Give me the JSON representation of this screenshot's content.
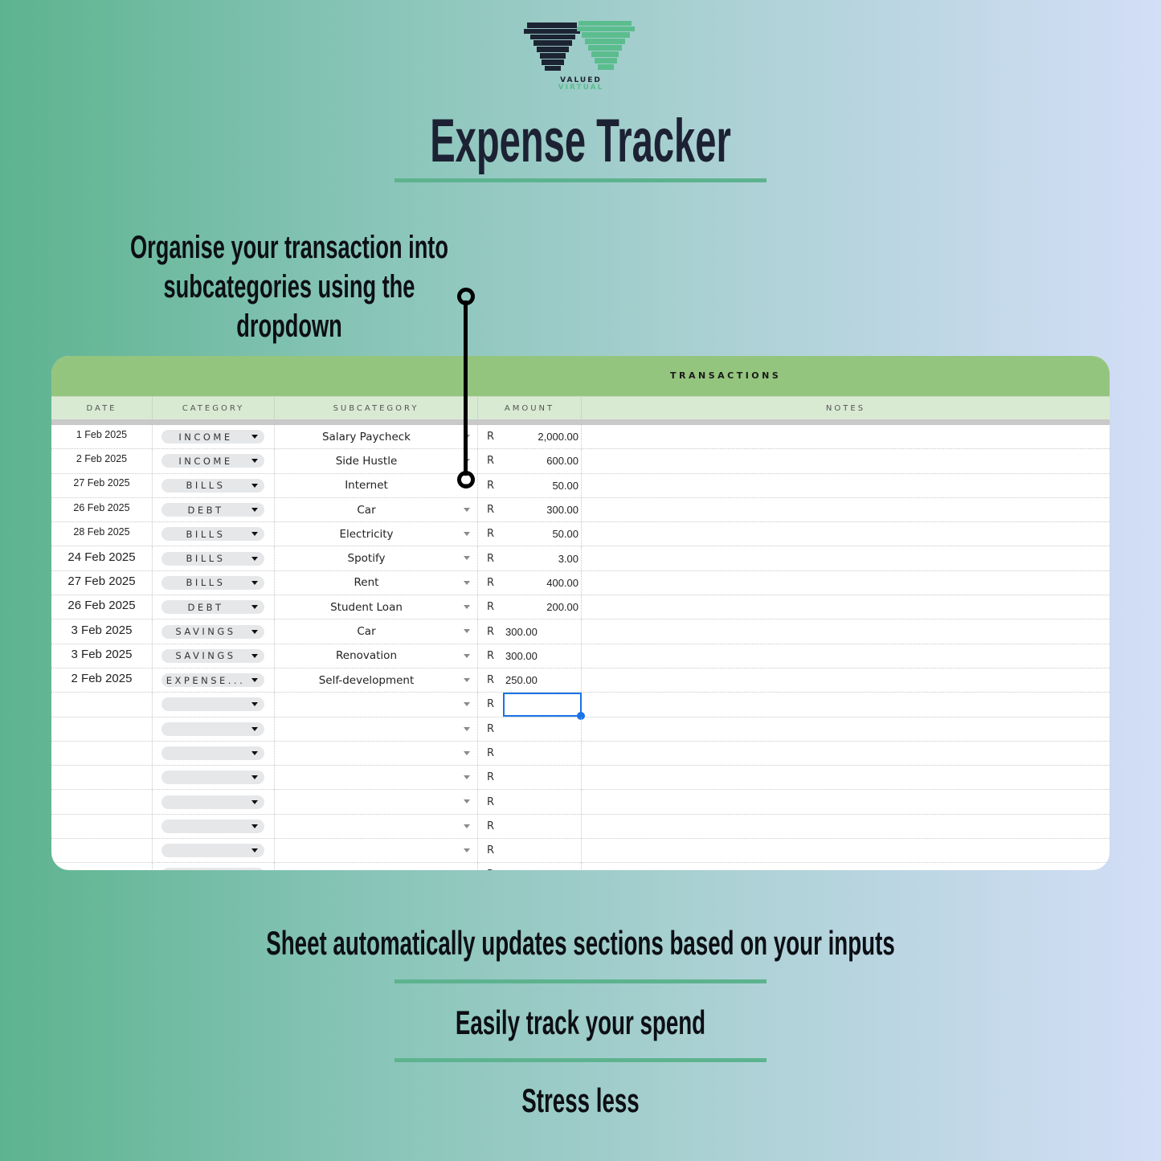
{
  "brand": {
    "logo_icon": "vv-glitch-logo-icon",
    "line1": "VALUED",
    "line2": "VIRTUAL",
    "colors": {
      "dark": "#1c2433",
      "green": "#5bbd8e"
    }
  },
  "title": "Expense Tracker",
  "callout": {
    "lines": [
      "Organise your transaction into",
      "subcategories using the",
      "dropdown"
    ]
  },
  "sheet": {
    "banner_title": "TRANSACTIONS",
    "columns": [
      "DATE",
      "CATEGORY",
      "SUBCATEGORY",
      "AMOUNT",
      "NOTES"
    ],
    "currency": "R",
    "rows": [
      {
        "date": "1 Feb 2025",
        "category": "INCOME",
        "subcategory": "Salary Paycheck",
        "amount": "2,000.00",
        "notes": ""
      },
      {
        "date": "2 Feb 2025",
        "category": "INCOME",
        "subcategory": "Side Hustle",
        "amount": "600.00",
        "notes": ""
      },
      {
        "date": "27 Feb 2025",
        "category": "BILLS",
        "subcategory": "Internet",
        "amount": "50.00",
        "notes": ""
      },
      {
        "date": "26 Feb 2025",
        "category": "DEBT",
        "subcategory": "Car",
        "amount": "300.00",
        "notes": ""
      },
      {
        "date": "28 Feb 2025",
        "category": "BILLS",
        "subcategory": "Electricity",
        "amount": "50.00",
        "notes": ""
      },
      {
        "date": "24 Feb 2025",
        "category": "BILLS",
        "subcategory": "Spotify",
        "amount": "3.00",
        "notes": ""
      },
      {
        "date": "27 Feb 2025",
        "category": "BILLS",
        "subcategory": "Rent",
        "amount": "400.00",
        "notes": ""
      },
      {
        "date": "26 Feb 2025",
        "category": "DEBT",
        "subcategory": "Student Loan",
        "amount": "200.00",
        "notes": ""
      },
      {
        "date": "3 Feb 2025",
        "category": "SAVINGS",
        "subcategory": "Car",
        "amount": "300.00",
        "notes": ""
      },
      {
        "date": "3 Feb 2025",
        "category": "SAVINGS",
        "subcategory": "Renovation",
        "amount": "300.00",
        "notes": ""
      },
      {
        "date": "2 Feb 2025",
        "category": "EXPENSE...",
        "subcategory": "Self-development",
        "amount": "250.00",
        "notes": ""
      },
      {
        "date": "",
        "category": "",
        "subcategory": "",
        "amount": "",
        "notes": "",
        "selected": true
      },
      {
        "date": "",
        "category": "",
        "subcategory": "",
        "amount": "",
        "notes": ""
      },
      {
        "date": "",
        "category": "",
        "subcategory": "",
        "amount": "",
        "notes": ""
      },
      {
        "date": "",
        "category": "",
        "subcategory": "",
        "amount": "",
        "notes": ""
      },
      {
        "date": "",
        "category": "",
        "subcategory": "",
        "amount": "",
        "notes": ""
      },
      {
        "date": "",
        "category": "",
        "subcategory": "",
        "amount": "",
        "notes": ""
      },
      {
        "date": "",
        "category": "",
        "subcategory": "",
        "amount": "",
        "notes": ""
      },
      {
        "date": "",
        "category": "",
        "subcategory": "",
        "amount": "",
        "notes": ""
      }
    ],
    "colors": {
      "banner": "#94c57e",
      "header": "#d9ead3",
      "selection": "#1a73e8"
    }
  },
  "taglines": [
    "Sheet automatically updates sections based on your inputs",
    "Easily track your spend",
    "Stress less"
  ],
  "accent_color": "#5db38f"
}
